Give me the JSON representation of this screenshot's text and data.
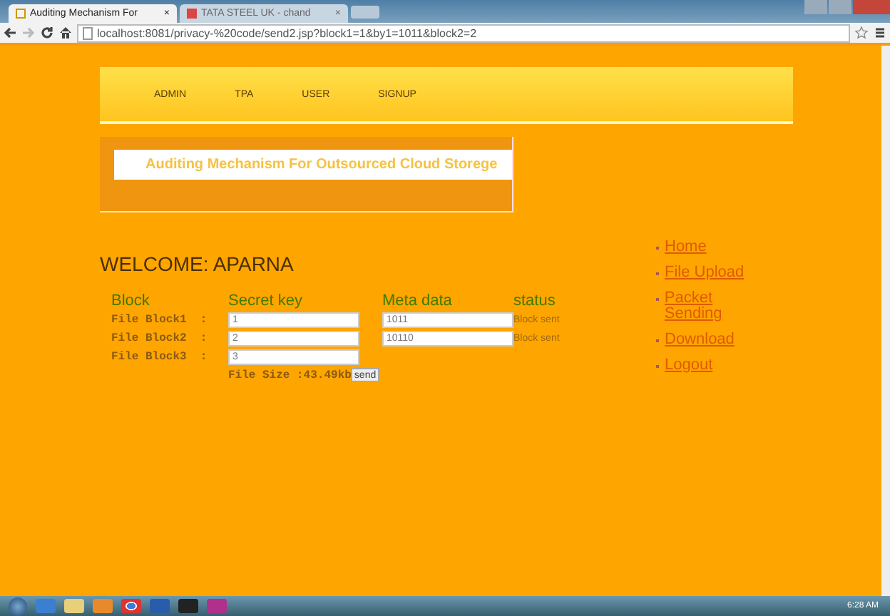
{
  "browser": {
    "tabs": [
      {
        "title": "Auditing Mechanism For",
        "close": "×",
        "selected": true
      },
      {
        "title": "TATA STEEL UK - chand",
        "close": "×",
        "selected": false
      }
    ],
    "url": "localhost:8081/privacy-%20code/send2.jsp?block1=1&by1=1011&block2=2"
  },
  "nav": [
    "ADMIN",
    "TPA",
    "USER",
    "SIGNUP"
  ],
  "banner": "Auditing Mechanism For Outsourced Cloud Storege",
  "welcome": "WELCOME: APARNA",
  "table": {
    "columns": [
      "Block",
      "Secret key",
      "Meta data",
      "status"
    ],
    "rows": [
      {
        "label": "File Block1  :",
        "key": "1",
        "meta": "1011",
        "status": "Block sent"
      },
      {
        "label": "File Block2  :",
        "key": "2",
        "meta": "10110",
        "status": "Block sent"
      },
      {
        "label": "File Block3  :",
        "key": "3"
      }
    ]
  },
  "file_size": "File Size :43.49kb",
  "send_button": "send",
  "links": [
    "Home",
    "File Upload",
    "Packet Sending",
    "Download",
    "Logout"
  ],
  "taskbar": {
    "time": "6:28 AM"
  }
}
